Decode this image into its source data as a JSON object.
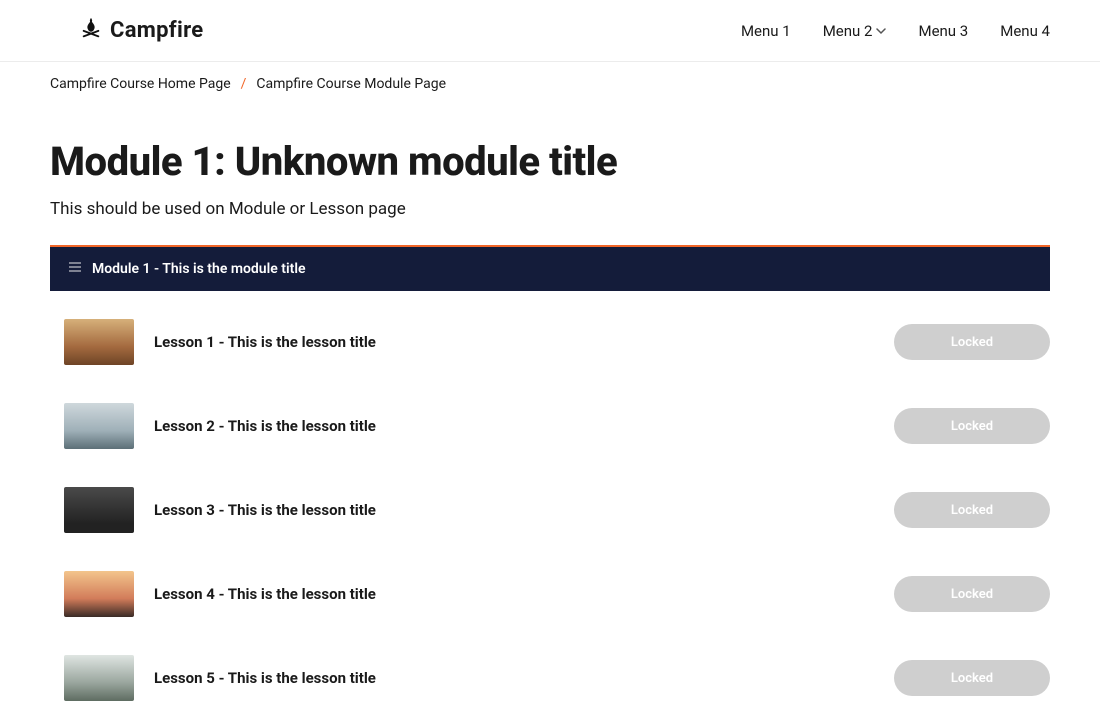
{
  "brand": "Campfire",
  "nav": {
    "items": [
      "Menu 1",
      "Menu 2",
      "Menu 3",
      "Menu 4"
    ]
  },
  "breadcrumb": {
    "home": "Campfire Course Home Page",
    "current": "Campfire Course Module Page"
  },
  "page": {
    "title": "Module 1: Unknown module title",
    "subtitle": "This should be used on Module or Lesson page"
  },
  "module": {
    "header": "Module 1 - This is the module title"
  },
  "lessons": [
    {
      "title": "Lesson 1 - This is the lesson title",
      "status": "Locked"
    },
    {
      "title": "Lesson 2 - This is the lesson title",
      "status": "Locked"
    },
    {
      "title": "Lesson 3 - This is the lesson title",
      "status": "Locked"
    },
    {
      "title": "Lesson 4 - This is the lesson title",
      "status": "Locked"
    },
    {
      "title": "Lesson 5 - This is the lesson title",
      "status": "Locked"
    }
  ]
}
